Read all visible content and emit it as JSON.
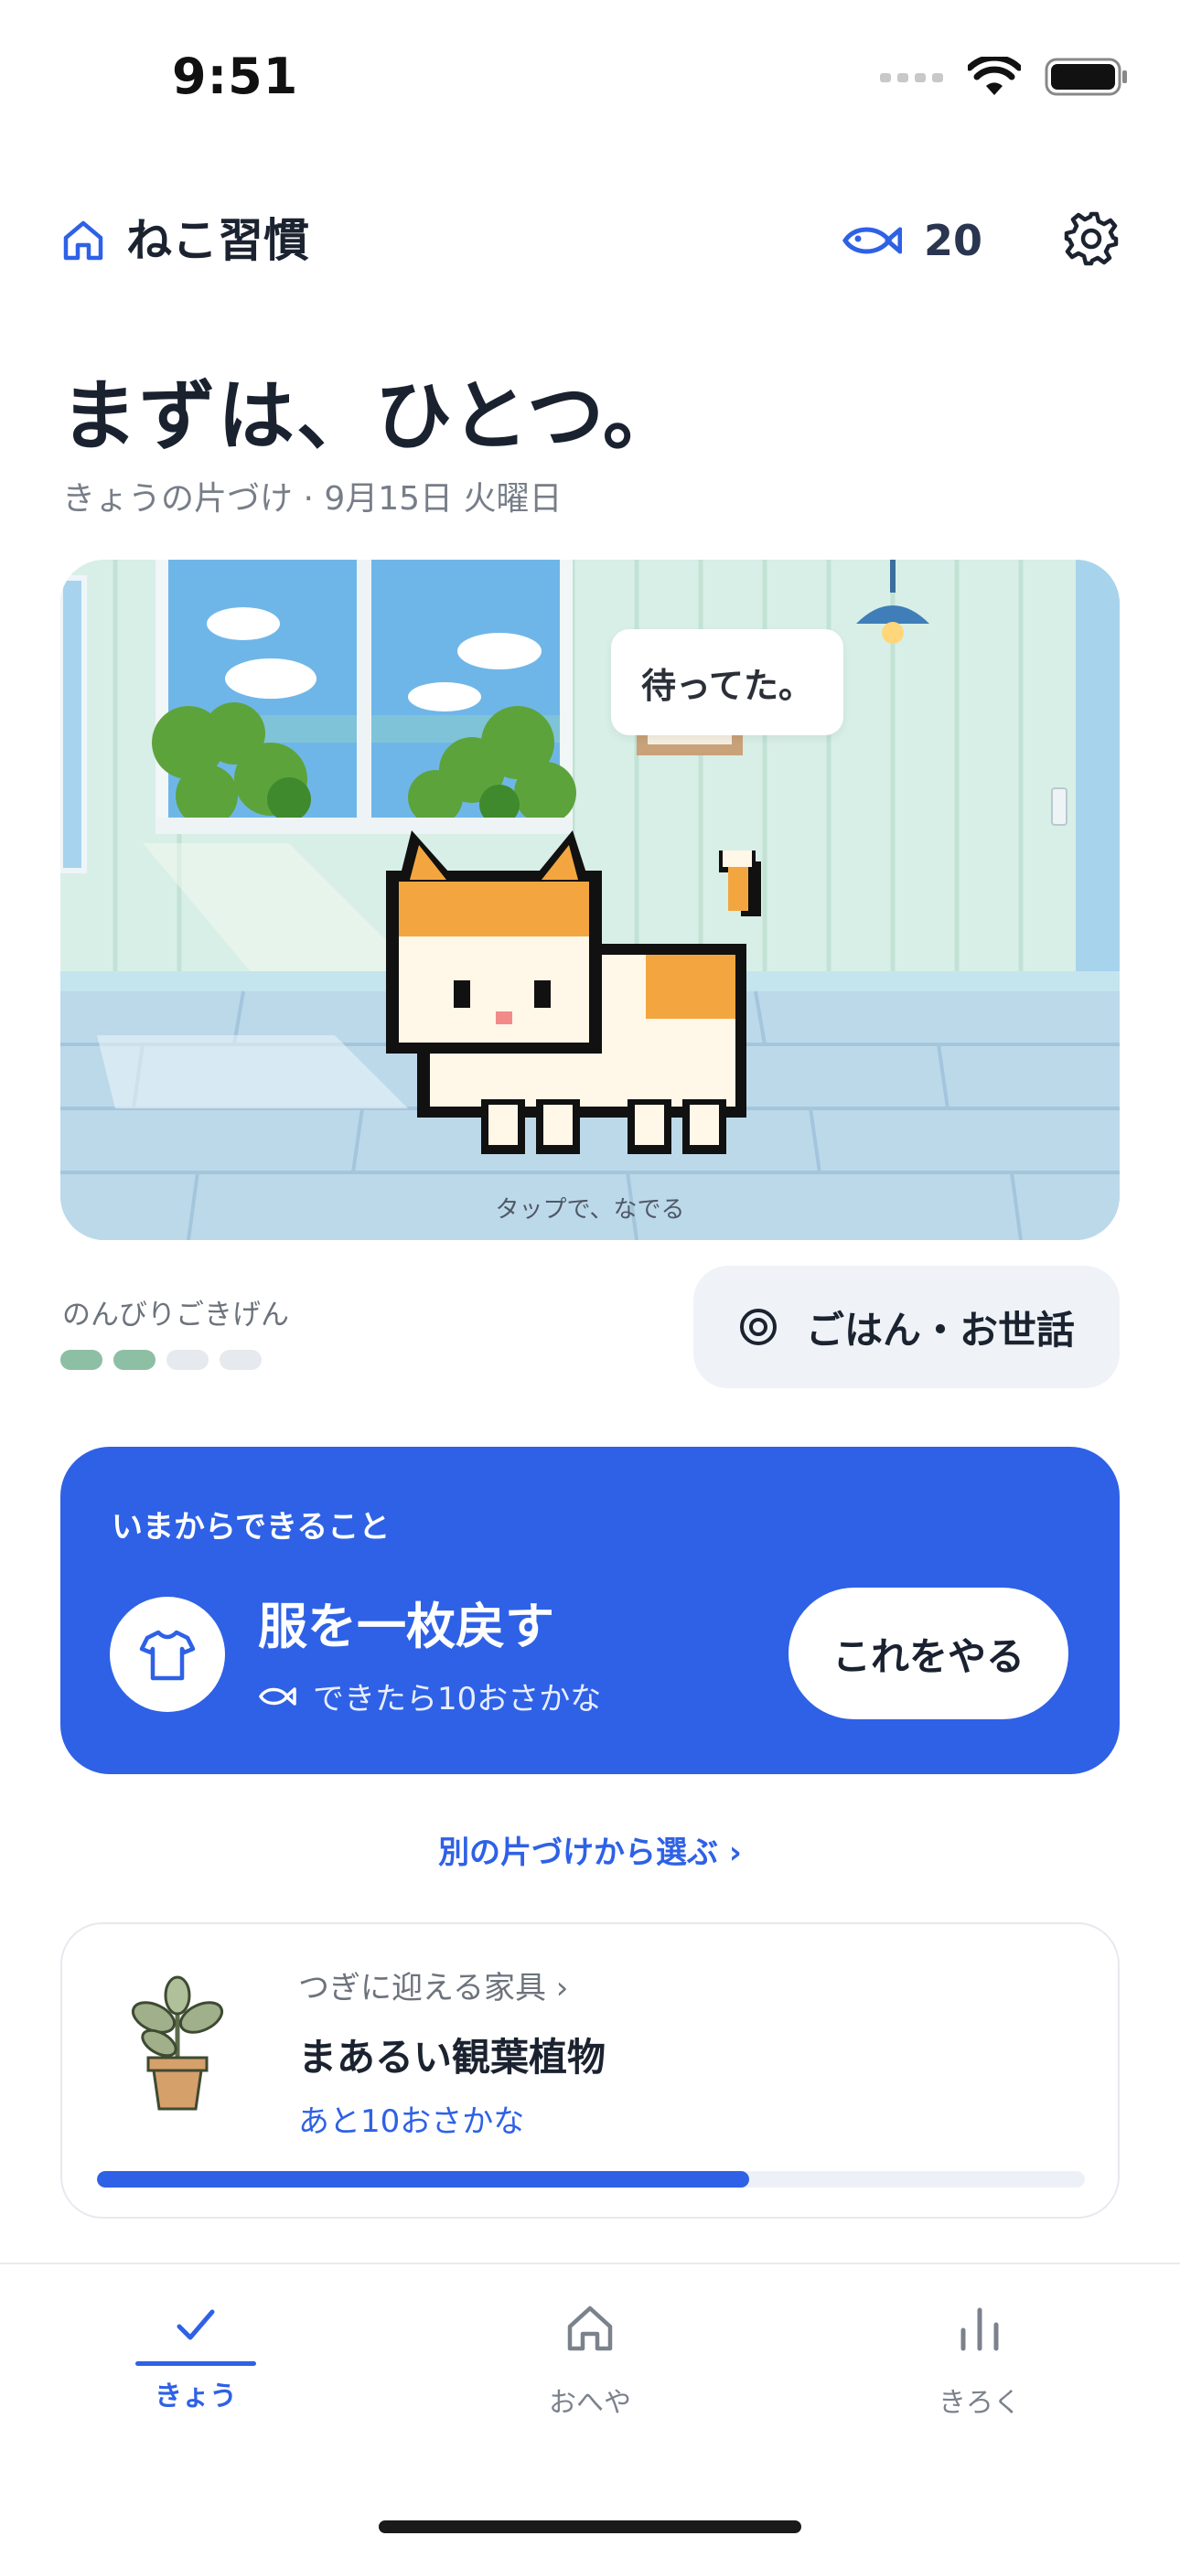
{
  "status_bar": {
    "time": "9:51"
  },
  "header": {
    "app_title": "ねこ習慣",
    "fish_count": "20"
  },
  "greeting": {
    "title": "まずは、ひとつ。",
    "subtitle": "きょうの片づけ · 9月15日 火曜日"
  },
  "scene": {
    "speech": "待ってた。",
    "hint": "タップで、なでる"
  },
  "mood": {
    "label": "のんびりごきげん",
    "level": 2,
    "max": 4,
    "filled_color": "#8dbfa4",
    "empty_color": "#e6e9ee"
  },
  "care_button": {
    "label": "ごはん・お世話"
  },
  "task_card": {
    "label": "いまからできること",
    "title": "服を一枚戻す",
    "reward": "できたら10おさかな",
    "action": "これをやる",
    "color": "#2e61e6"
  },
  "other_link": "別の片づけから選ぶ ›",
  "furniture": {
    "label": "つぎに迎える家具 ›",
    "name": "まあるい観葉植物",
    "remaining": "あと10おさかな",
    "progress": 0.66
  },
  "tabs": [
    {
      "label": "きょう",
      "icon": "check-icon",
      "active": true
    },
    {
      "label": "おへや",
      "icon": "house-icon",
      "active": false
    },
    {
      "label": "きろく",
      "icon": "bar-chart-icon",
      "active": false
    }
  ]
}
